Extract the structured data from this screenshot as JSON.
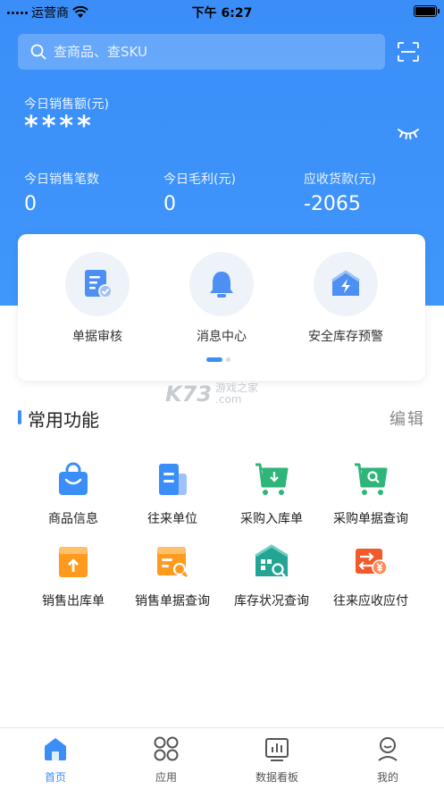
{
  "status_bar": {
    "carrier": "运营商",
    "time": "下午 6:27"
  },
  "search": {
    "placeholder": "查商品、查SKU"
  },
  "sales": {
    "label": "今日销售额(元)",
    "value": "****"
  },
  "stats": [
    {
      "label": "今日销售笔数",
      "value": "0"
    },
    {
      "label": "今日毛利(元)",
      "value": "0"
    },
    {
      "label": "应收货款(元)",
      "value": "-2065"
    }
  ],
  "quick_actions": [
    {
      "label": "单据审核",
      "icon": "document-check-icon"
    },
    {
      "label": "消息中心",
      "icon": "bell-icon"
    },
    {
      "label": "安全库存预警",
      "icon": "warehouse-alert-icon"
    }
  ],
  "watermark": {
    "big": "K73",
    "line1": "游戏之家",
    "line2": ".com"
  },
  "section": {
    "title": "常用功能",
    "edit": "编辑"
  },
  "functions": [
    {
      "label": "商品信息",
      "icon": "shopping-bag-icon"
    },
    {
      "label": "往来单位",
      "icon": "building-icon"
    },
    {
      "label": "采购入库单",
      "icon": "cart-inbound-icon"
    },
    {
      "label": "采购单据查询",
      "icon": "cart-search-icon"
    },
    {
      "label": "销售出库单",
      "icon": "box-outbound-icon"
    },
    {
      "label": "销售单据查询",
      "icon": "sales-search-icon"
    },
    {
      "label": "库存状况查询",
      "icon": "warehouse-search-icon"
    },
    {
      "label": "往来应收应付",
      "icon": "exchange-yuan-icon"
    }
  ],
  "nav": [
    {
      "label": "首页",
      "icon": "home-icon",
      "active": true
    },
    {
      "label": "应用",
      "icon": "apps-icon"
    },
    {
      "label": "数据看板",
      "icon": "dashboard-icon"
    },
    {
      "label": "我的",
      "icon": "profile-icon"
    }
  ],
  "colors": {
    "primary": "#3b8ef8",
    "green": "#2fb57a",
    "orange": "#ff9a1f",
    "red": "#f2592b"
  }
}
